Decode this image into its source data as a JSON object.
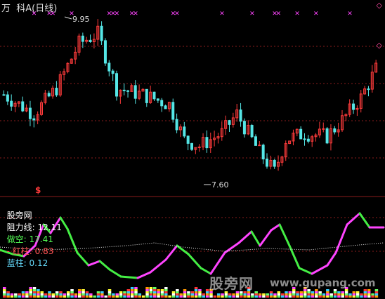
{
  "header": {
    "title": "万  科A(日线)",
    "diamond_top": "◇",
    "diamond_mid": "◇"
  },
  "price_panel": {
    "high_label": "9.95",
    "low_label": "7.60",
    "signal_mark": "$",
    "sell_markers": "✕"
  },
  "indicator_panel": {
    "name": "股旁网",
    "items": [
      {
        "label": "阻力线: 12.11",
        "color": "#ffffff"
      },
      {
        "label": "做空: 17.41",
        "color": "#55ff55"
      },
      {
        "label": "- 红柱: 0.83",
        "color": "#ff5555"
      },
      {
        "label": "蓝柱: 0.12",
        "color": "#66ddff"
      }
    ]
  },
  "watermark": {
    "text": "股旁网",
    "url": "www.gupang.com"
  },
  "chart_data": {
    "type": "line",
    "title": "万  科A(日线)",
    "price_range": [
      7.4,
      10.2
    ],
    "annotations": [
      {
        "label": "9.95",
        "value": 9.95
      },
      {
        "label": "7.60",
        "value": 7.6
      }
    ],
    "colors": {
      "up": "#ff3b3b",
      "down": "#55e6e6",
      "grid": "#8a1c1c",
      "resist_up": "#ff44ff",
      "resist_down": "#44ee44"
    }
  }
}
